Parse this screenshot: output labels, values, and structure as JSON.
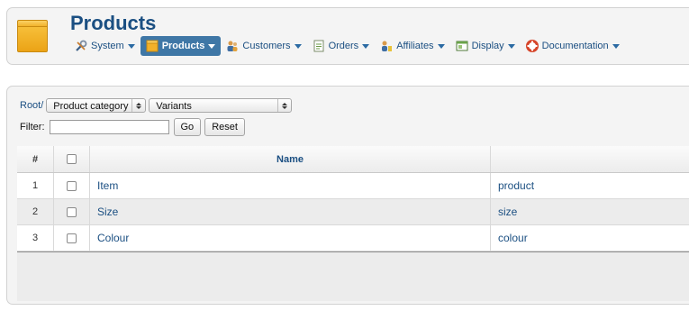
{
  "header": {
    "title": "Products",
    "menu": [
      {
        "label": "System",
        "icon": "wrench-icon",
        "active": false
      },
      {
        "label": "Products",
        "icon": "box-icon",
        "active": true
      },
      {
        "label": "Customers",
        "icon": "customers-icon",
        "active": false
      },
      {
        "label": "Orders",
        "icon": "orders-icon",
        "active": false
      },
      {
        "label": "Affiliates",
        "icon": "affiliates-icon",
        "active": false
      },
      {
        "label": "Display",
        "icon": "display-icon",
        "active": false
      },
      {
        "label": "Documentation",
        "icon": "lifebuoy-icon",
        "active": false
      }
    ]
  },
  "content": {
    "breadcrumb": {
      "root_label": "Root/",
      "category_select": "Product category",
      "variant_select": "Variants"
    },
    "filter": {
      "label": "Filter:",
      "value": "",
      "go_label": "Go",
      "reset_label": "Reset"
    },
    "table": {
      "columns": {
        "number": "#",
        "name": "Name",
        "slug": ""
      },
      "rows": [
        {
          "number": "1",
          "name": "Item",
          "slug": "product"
        },
        {
          "number": "2",
          "name": "Size",
          "slug": "size"
        },
        {
          "number": "3",
          "name": "Colour",
          "slug": "colour"
        }
      ]
    }
  },
  "colors": {
    "accent": "#1b4f82",
    "active_menu": "#3f77a6",
    "panel": "#f4f4f4"
  }
}
